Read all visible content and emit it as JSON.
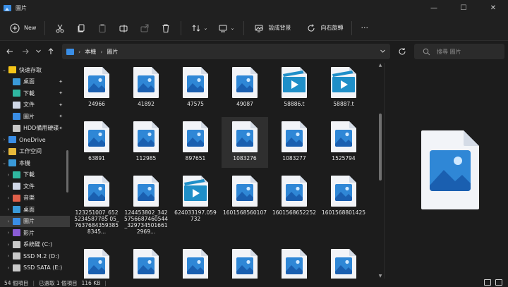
{
  "window": {
    "title": "圖片",
    "controls": {
      "minimize": "—",
      "maximize": "☐",
      "close": "✕"
    }
  },
  "toolbar": {
    "new_label": "New",
    "wallpaper_label": "設成背景",
    "rotate_label": "向右旋轉",
    "more_label": "···"
  },
  "address": {
    "crumbs": [
      "本機",
      "圖片"
    ],
    "separator": "›"
  },
  "search": {
    "placeholder": "搜尋 圖片"
  },
  "sidebar": {
    "items": [
      {
        "label": "快速存取",
        "icon": "star-icon",
        "color": "#f5c518",
        "chev": "⌄",
        "indent": 0
      },
      {
        "label": "桌面",
        "icon": "desktop-icon",
        "color": "#3a9ad9",
        "pin": true,
        "indent": 1
      },
      {
        "label": "下載",
        "icon": "download-icon",
        "color": "#2fb6a0",
        "pin": true,
        "indent": 1
      },
      {
        "label": "文件",
        "icon": "document-icon",
        "color": "#cfd7e6",
        "pin": true,
        "indent": 1
      },
      {
        "label": "圖片",
        "icon": "pictures-icon",
        "color": "#3a8ee6",
        "pin": true,
        "indent": 1
      },
      {
        "label": "HDD備用硬碟",
        "icon": "drive-icon",
        "color": "#c8c8c8",
        "pin": true,
        "indent": 1
      },
      {
        "label": "OneDrive",
        "icon": "cloud-icon",
        "color": "#3a8ee6",
        "chev": "›",
        "indent": 0
      },
      {
        "label": "工作空间",
        "icon": "folder-icon",
        "color": "#e8b93a",
        "chev": "›",
        "indent": 0
      },
      {
        "label": "本機",
        "icon": "computer-icon",
        "color": "#3a9ad9",
        "chev": "⌄",
        "indent": 0
      },
      {
        "label": "下載",
        "icon": "download-icon",
        "color": "#2fb6a0",
        "chev": "›",
        "indent": 1
      },
      {
        "label": "文件",
        "icon": "document-icon",
        "color": "#cfd7e6",
        "chev": "›",
        "indent": 1
      },
      {
        "label": "音樂",
        "icon": "music-icon",
        "color": "#e0604a",
        "chev": "›",
        "indent": 1
      },
      {
        "label": "桌面",
        "icon": "desktop-icon",
        "color": "#3a9ad9",
        "chev": "›",
        "indent": 1
      },
      {
        "label": "圖片",
        "icon": "pictures-icon",
        "color": "#3a8ee6",
        "chev": "›",
        "indent": 1,
        "selected": true
      },
      {
        "label": "影片",
        "icon": "video-icon",
        "color": "#8a5cd6",
        "chev": "›",
        "indent": 1
      },
      {
        "label": "系統碟 (C:)",
        "icon": "drive-icon",
        "color": "#c8c8c8",
        "chev": "›",
        "indent": 1
      },
      {
        "label": "SSD M.2 (D:)",
        "icon": "drive-icon",
        "color": "#c8c8c8",
        "chev": "›",
        "indent": 1
      },
      {
        "label": "SSD SATA (E:)",
        "icon": "drive-icon",
        "color": "#c8c8c8",
        "chev": "›",
        "indent": 1
      }
    ]
  },
  "files": [
    {
      "name": "24966",
      "type": "image"
    },
    {
      "name": "41892",
      "type": "image"
    },
    {
      "name": "47575",
      "type": "image"
    },
    {
      "name": "49087",
      "type": "image"
    },
    {
      "name": "58886.t",
      "type": "video"
    },
    {
      "name": "58887.t",
      "type": "video"
    },
    {
      "name": "63891",
      "type": "image"
    },
    {
      "name": "112985",
      "type": "image"
    },
    {
      "name": "897651",
      "type": "image"
    },
    {
      "name": "1083276",
      "type": "image",
      "selected": true
    },
    {
      "name": "1083277",
      "type": "image"
    },
    {
      "name": "1525794",
      "type": "image"
    },
    {
      "name": "123251007_6525234587785 05_76376843593858345...",
      "type": "image"
    },
    {
      "name": "124453802_3425756687460544_3297345016612969...",
      "type": "image"
    },
    {
      "name": "624033197.059732",
      "type": "video"
    },
    {
      "name": "1601568560107",
      "type": "image"
    },
    {
      "name": "1601568652252",
      "type": "image"
    },
    {
      "name": "1601568801425",
      "type": "image"
    },
    {
      "name": "",
      "type": "image"
    },
    {
      "name": "",
      "type": "image"
    },
    {
      "name": "",
      "type": "image"
    },
    {
      "name": "",
      "type": "image"
    },
    {
      "name": "",
      "type": "image"
    },
    {
      "name": "",
      "type": "image"
    }
  ],
  "status": {
    "count": "54 個項目",
    "selected": "已選取 1 個項目",
    "size": "116 KB"
  },
  "colors": {
    "accent": "#3a8ee6",
    "file_page": "#f2f4f8",
    "video_blue": "#1f8fc8"
  }
}
